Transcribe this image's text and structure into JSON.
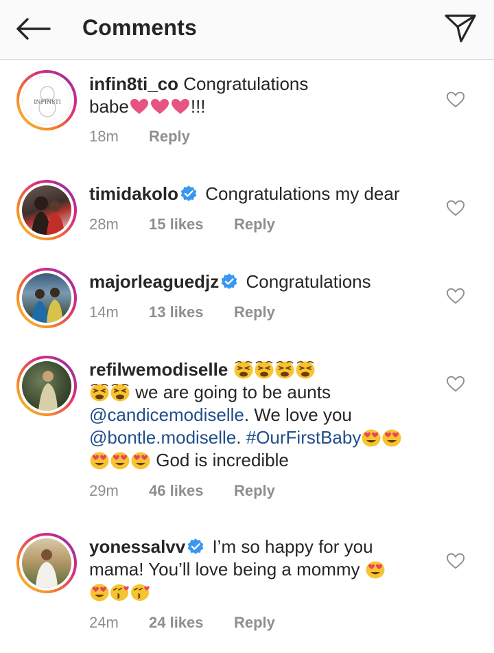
{
  "header": {
    "title": "Comments",
    "back_icon": "arrow-left-icon",
    "send_icon": "paper-plane-icon"
  },
  "colors": {
    "text": "#262626",
    "meta": "#8e8e8e",
    "mention": "#1f4e8a",
    "verified": "#3897f0",
    "heart": "#e1306c"
  },
  "comments": [
    {
      "username": "infin8ti_co",
      "text_line1": "Congratulations",
      "text_line2_pre": "babe",
      "text_line2_post": "!!!",
      "time": "18m",
      "likes": "",
      "reply": "Reply",
      "avatar_label": "INFIN8TI",
      "emojis": [
        "heart",
        "heart",
        "heart"
      ]
    },
    {
      "username": "timidakolo",
      "verified": true,
      "text": "Congratulations my dear",
      "time": "28m",
      "likes": "15 likes",
      "reply": "Reply"
    },
    {
      "username": "majorleaguedjz",
      "verified": true,
      "text": "Congratulations",
      "time": "14m",
      "likes": "13 likes",
      "reply": "Reply"
    },
    {
      "username": "refilwemodiselle",
      "text_line2": "we are going to be aunts",
      "mention1": "@candicemodiselle",
      "text_after_mention1": ". We love you",
      "mention2": "@bontle.modiselle",
      "text_after_mention2": ". ",
      "hashtag": "#OurFirstBaby",
      "text_line4": "God is incredible",
      "time": "29m",
      "likes": "46 likes",
      "reply": "Reply",
      "emojis": [
        "tired-face",
        "heart-eyes",
        "heart-eyes"
      ]
    },
    {
      "username": "yonessalvv",
      "verified": true,
      "text_line1": "I’m so happy for you",
      "text_line2": "mama! You’ll love being a mommy",
      "time": "24m",
      "likes": "24 likes",
      "reply": "Reply",
      "emojis": [
        "heart-eyes",
        "kissing-heart"
      ]
    }
  ]
}
